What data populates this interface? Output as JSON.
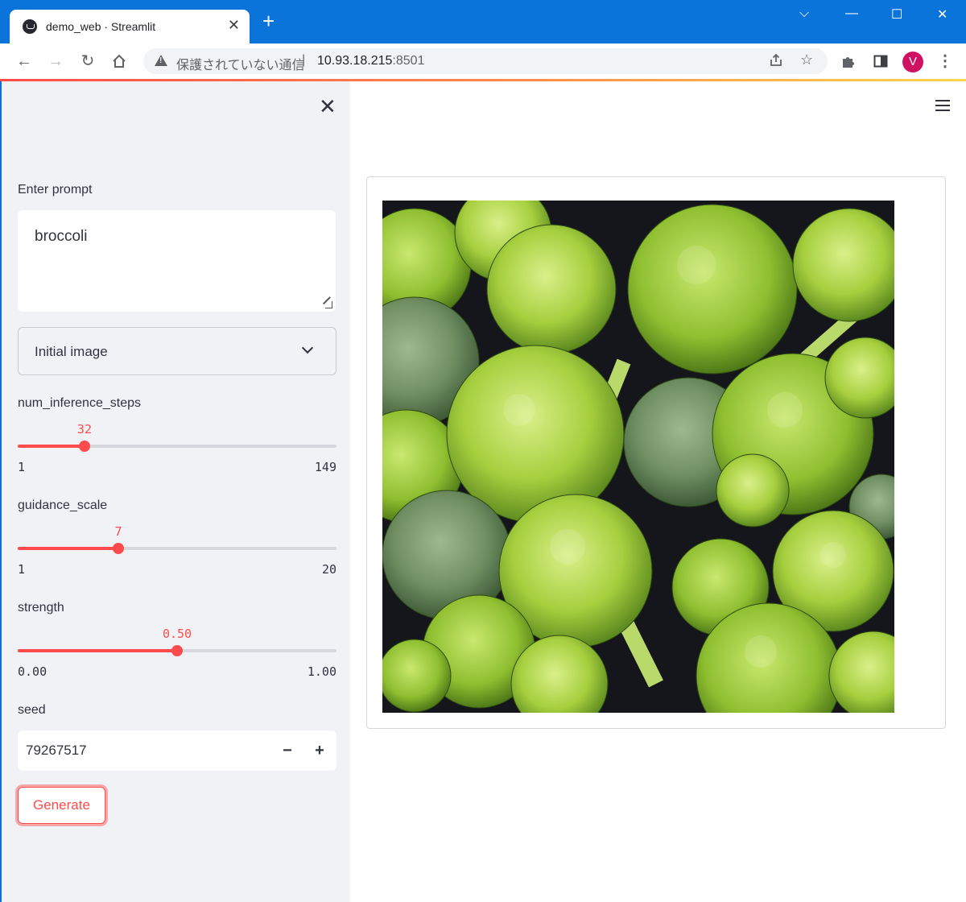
{
  "browser": {
    "tab_title": "demo_web · Streamlit",
    "tab_close": "✕",
    "new_tab": "+",
    "security_text": "保護されていない通信",
    "url_host": "10.93.18.215",
    "url_port": ":8501",
    "avatar_letter": "V",
    "window_controls": {
      "tabs_menu": "⌵",
      "minimize": "—",
      "maximize": "☐",
      "close": "✕"
    }
  },
  "sidebar": {
    "close_icon": "✕",
    "prompt": {
      "label": "Enter prompt",
      "value": "broccoli"
    },
    "initial_image": {
      "selected": "Initial image"
    },
    "sliders": [
      {
        "label": "num_inference_steps",
        "value": "32",
        "min": "1",
        "max": "149",
        "fraction": 0.2095
      },
      {
        "label": "guidance_scale",
        "value": "7",
        "min": "1",
        "max": "20",
        "fraction": 0.3158
      },
      {
        "label": "strength",
        "value": "0.50",
        "min": "0.00",
        "max": "1.00",
        "fraction": 0.5
      }
    ],
    "seed": {
      "label": "seed",
      "value": "79267517",
      "minus": "−",
      "plus": "+"
    },
    "generate_label": "Generate"
  },
  "colors": {
    "accent": "#ff4b4b",
    "sidebar_bg": "#f0f2f6",
    "titlebar": "#0a74da"
  }
}
